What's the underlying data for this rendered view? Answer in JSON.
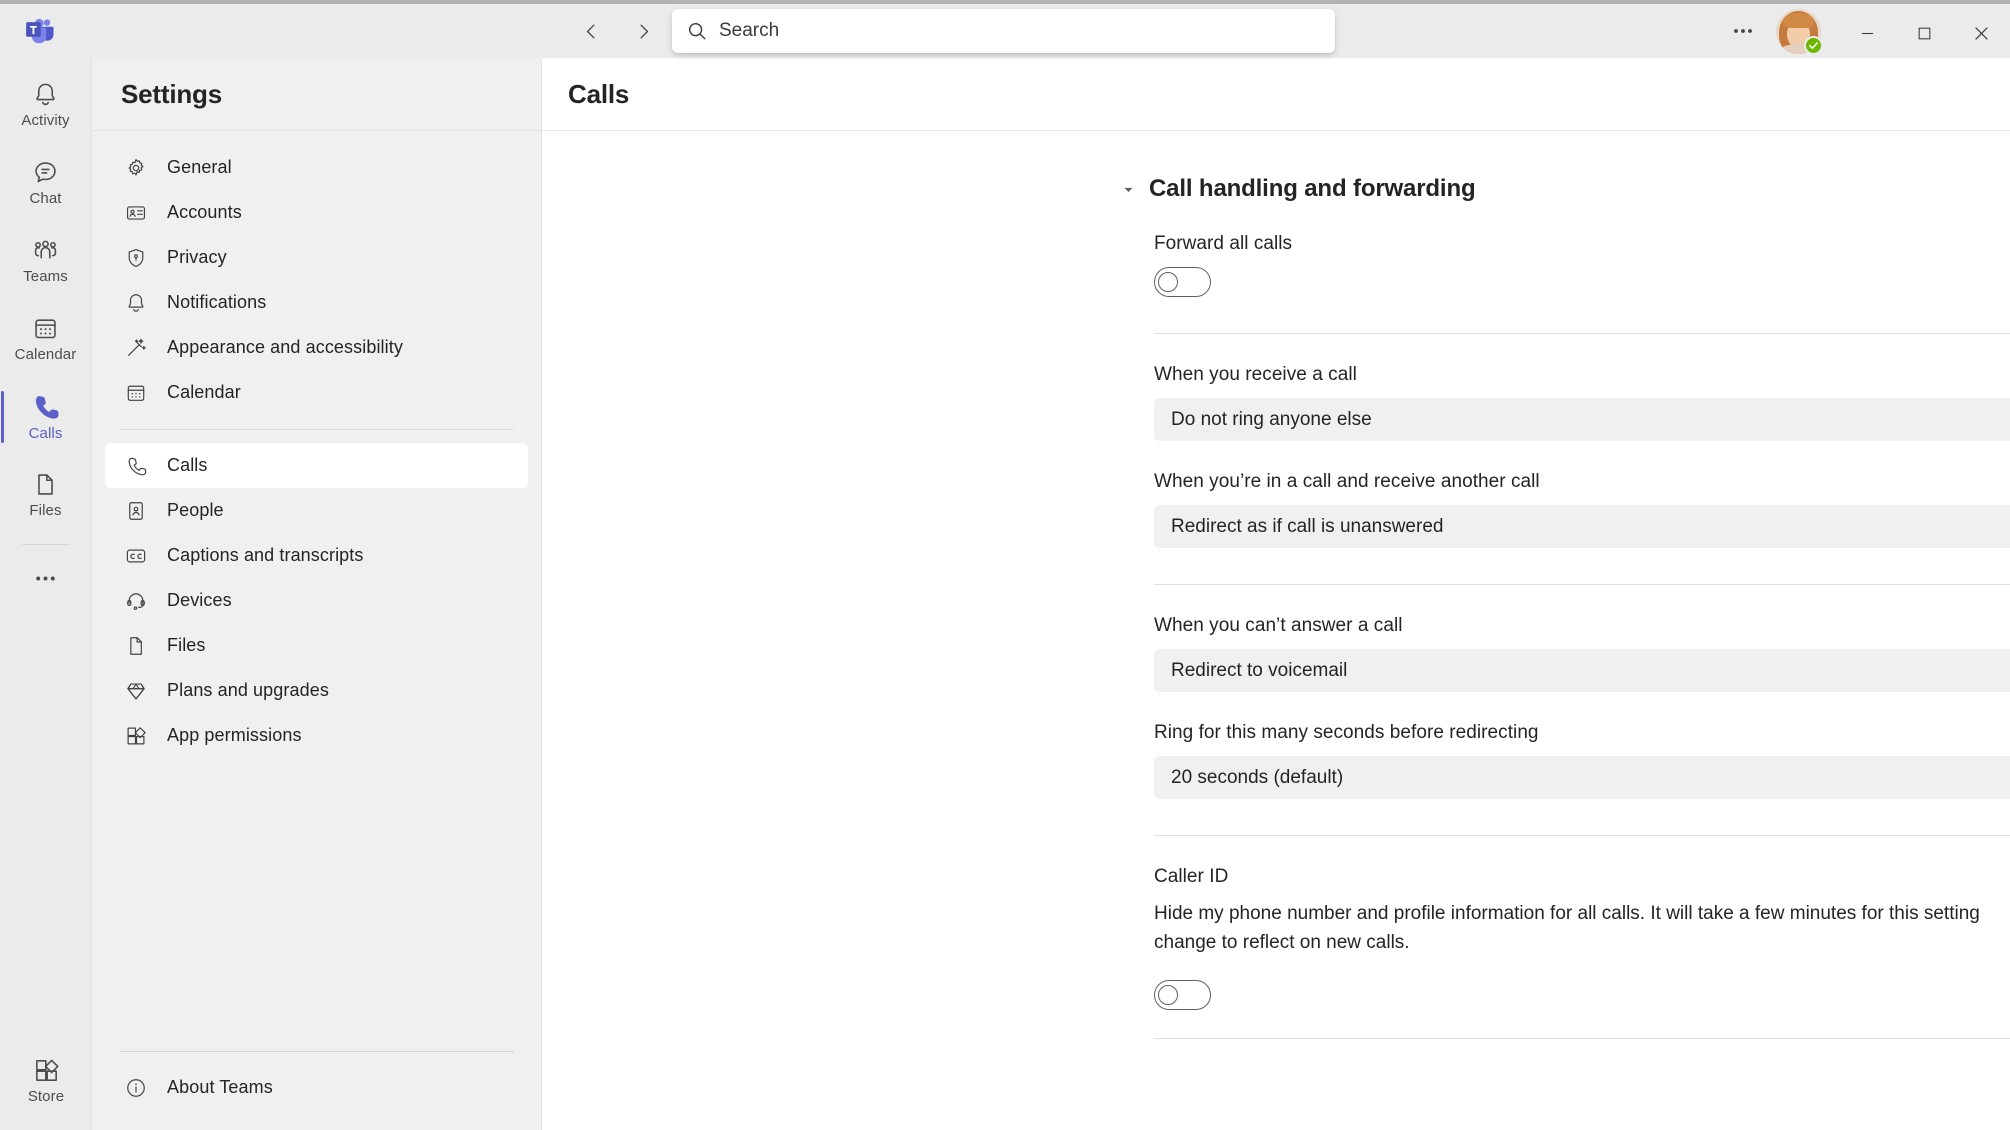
{
  "titlebar": {
    "logo_icon": "teams-logo-icon",
    "back_icon": "chevron-left-icon",
    "forward_icon": "chevron-right-icon",
    "search_icon": "search-icon",
    "search_placeholder": "Search",
    "search_value": "",
    "more_icon": "ellipsis-icon",
    "avatar_icon": "user-avatar",
    "presence_status": "available",
    "presence_icon": "check-icon",
    "minimize_icon": "minimize-icon",
    "maximize_icon": "maximize-icon",
    "close_icon": "close-icon"
  },
  "rail": {
    "items": [
      {
        "label": "Activity",
        "icon": "bell-icon",
        "active": false
      },
      {
        "label": "Chat",
        "icon": "chat-bubble-icon",
        "active": false
      },
      {
        "label": "Teams",
        "icon": "people-group-icon",
        "active": false
      },
      {
        "label": "Calendar",
        "icon": "calendar-icon",
        "active": false
      },
      {
        "label": "Calls",
        "icon": "phone-icon",
        "active": true
      },
      {
        "label": "Files",
        "icon": "file-icon",
        "active": false
      }
    ],
    "more_icon": "ellipsis-icon",
    "store": {
      "label": "Store",
      "icon": "store-icon"
    }
  },
  "sidebar": {
    "title": "Settings",
    "items": [
      {
        "label": "General",
        "icon": "gear-icon",
        "selected": false
      },
      {
        "label": "Accounts",
        "icon": "id-card-icon",
        "selected": false
      },
      {
        "label": "Privacy",
        "icon": "shield-lock-icon",
        "selected": false
      },
      {
        "label": "Notifications",
        "icon": "bell-icon",
        "selected": false
      },
      {
        "label": "Appearance and accessibility",
        "icon": "magic-wand-icon",
        "selected": false
      },
      {
        "label": "Calendar",
        "icon": "calendar-icon",
        "selected": false
      },
      {
        "label": "Calls",
        "icon": "phone-icon",
        "selected": true
      },
      {
        "label": "People",
        "icon": "contact-card-icon",
        "selected": false
      },
      {
        "label": "Captions and transcripts",
        "icon": "closed-caption-icon",
        "selected": false
      },
      {
        "label": "Devices",
        "icon": "headset-icon",
        "selected": false
      },
      {
        "label": "Files",
        "icon": "file-icon",
        "selected": false
      },
      {
        "label": "Plans and upgrades",
        "icon": "diamond-icon",
        "selected": false
      },
      {
        "label": "App permissions",
        "icon": "apps-icon",
        "selected": false
      }
    ],
    "footer": {
      "label": "About Teams",
      "icon": "info-icon"
    }
  },
  "main": {
    "page_title": "Calls",
    "section": {
      "title": "Call handling and forwarding",
      "expanded": true,
      "collapse_icon": "chevron-down-small-icon"
    },
    "forward_all_calls": {
      "label": "Forward all calls",
      "toggle_state": "off"
    },
    "fields": [
      {
        "label": "When you receive a call",
        "value": "Do not ring anyone else",
        "chevron_icon": "chevron-down-icon"
      },
      {
        "label": "When you’re in a call and receive another call",
        "value": "Redirect as if call is unanswered",
        "chevron_icon": "chevron-down-icon"
      },
      {
        "label": "When you can’t answer a call",
        "value": "Redirect to voicemail",
        "chevron_icon": "chevron-down-icon"
      },
      {
        "label": "Ring for this many seconds before redirecting",
        "value": "20 seconds (default)",
        "chevron_icon": "chevron-down-icon"
      }
    ],
    "caller_id": {
      "label": "Caller ID",
      "description": "Hide my phone number and profile information for all calls. It will take a few minutes for this setting change to reflect on new calls.",
      "toggle_state": "off"
    }
  },
  "colors": {
    "accent": "#5b5fc7",
    "presence_available": "#6bb700",
    "window_bg": "#ebebeb",
    "sidebar_bg": "#f0f0f0",
    "content_bg": "#ffffff",
    "field_bg": "#f0f0f0",
    "text_primary": "#242424"
  }
}
